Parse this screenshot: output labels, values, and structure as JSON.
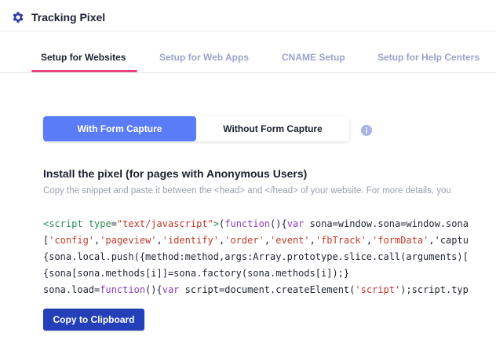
{
  "header": {
    "title": "Tracking Pixel",
    "icon": "gear-icon"
  },
  "tabs": [
    {
      "label": "Setup for Websites",
      "active": true
    },
    {
      "label": "Setup for Web Apps",
      "active": false
    },
    {
      "label": "CNAME Setup",
      "active": false
    },
    {
      "label": "Setup for Help Centers",
      "active": false
    }
  ],
  "segmented": {
    "options": [
      {
        "label": "With Form Capture",
        "selected": true
      },
      {
        "label": "Without Form Capture",
        "selected": false
      }
    ],
    "info_icon": "info-icon"
  },
  "section": {
    "title": "Install the pixel (for pages with Anonymous Users)",
    "description": "Copy the snippet and paste it between the <head> and </head> of your website. For more details, you"
  },
  "code_lines": [
    "<script type=\"text/javascript\">(function(){var sona=window.sona=window.sona",
    "['config','pageview','identify','order','event','fbTrack','formData','captu",
    "{sona.local.push({method:method,args:Array.prototype.slice.call(arguments)[",
    "{sona[sona.methods[i]]=sona.factory(sona.methods[i]);}",
    "sona.load=function(){var script=document.createElement('script');script.typ"
  ],
  "copy_button": {
    "label": "Copy to Clipboard"
  },
  "colors": {
    "accent": "#5b7cf7",
    "tab_underline": "#e8437a",
    "button": "#2440b8",
    "gear": "#2e3aa8"
  }
}
